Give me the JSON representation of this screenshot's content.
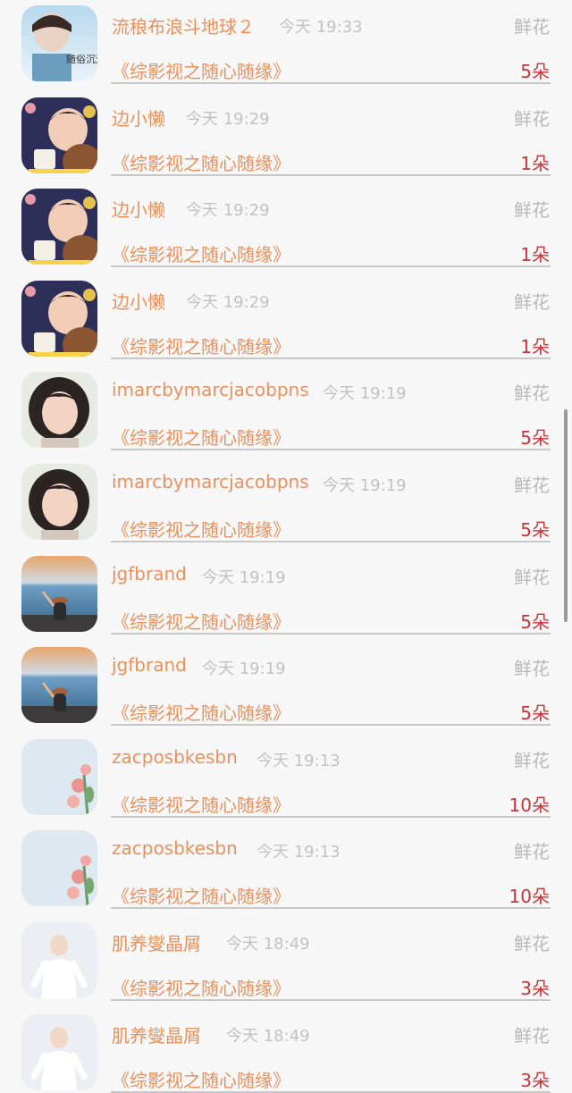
{
  "gifts": [
    {
      "avatar": "avatar-sky-calligraphy",
      "avatar_text": "随俗沉浮",
      "name": "流稂布浪斗地球２",
      "time": "今天 19:33",
      "type": "鲜花",
      "program": "《综影视之随心随缘》",
      "count": "5朵"
    },
    {
      "avatar": "avatar-toddler-cup",
      "name": "边小懒",
      "time": "今天 19:29",
      "type": "鲜花",
      "program": "《综影视之随心随缘》",
      "count": "1朵"
    },
    {
      "avatar": "avatar-toddler-cup",
      "name": "边小懒",
      "time": "今天 19:29",
      "type": "鲜花",
      "program": "《综影视之随心随缘》",
      "count": "1朵"
    },
    {
      "avatar": "avatar-toddler-cup",
      "name": "边小懒",
      "time": "今天 19:29",
      "type": "鲜花",
      "program": "《综影视之随心随缘》",
      "count": "1朵"
    },
    {
      "avatar": "avatar-curly-girl",
      "name": "imarcbymarcjacobpns",
      "time": "今天 19:19",
      "type": "鲜花",
      "program": "《综影视之随心随缘》",
      "count": "5朵"
    },
    {
      "avatar": "avatar-curly-girl",
      "name": "imarcbymarcjacobpns",
      "time": "今天 19:19",
      "type": "鲜花",
      "program": "《综影视之随心随缘》",
      "count": "5朵"
    },
    {
      "avatar": "avatar-seaside-hat",
      "name": "jgfbrand",
      "time": "今天 19:19",
      "type": "鲜花",
      "program": "《综影视之随心随缘》",
      "count": "5朵"
    },
    {
      "avatar": "avatar-seaside-hat",
      "name": "jgfbrand",
      "time": "今天 19:19",
      "type": "鲜花",
      "program": "《综影视之随心随缘》",
      "count": "5朵"
    },
    {
      "avatar": "avatar-pink-flowers",
      "name": "zacposbkesbn",
      "time": "今天 19:13",
      "type": "鲜花",
      "program": "《综影视之随心随缘》",
      "count": "10朵"
    },
    {
      "avatar": "avatar-pink-flowers",
      "name": "zacposbkesbn",
      "time": "今天 19:13",
      "type": "鲜花",
      "program": "《综影视之随心随缘》",
      "count": "10朵"
    },
    {
      "avatar": "avatar-white-child",
      "name": "肌养燮晶屑",
      "time": "今天 18:49",
      "type": "鲜花",
      "program": "《综影视之随心随缘》",
      "count": "3朵"
    },
    {
      "avatar": "avatar-white-child",
      "name": "肌养燮晶屑",
      "time": "今天 18:49",
      "type": "鲜花",
      "program": "《综影视之随心随缘》",
      "count": "3朵"
    }
  ],
  "colors": {
    "name": "#e8915c",
    "time": "#c2c2c2",
    "count": "#c9343a",
    "background": "#f7f7f7"
  }
}
